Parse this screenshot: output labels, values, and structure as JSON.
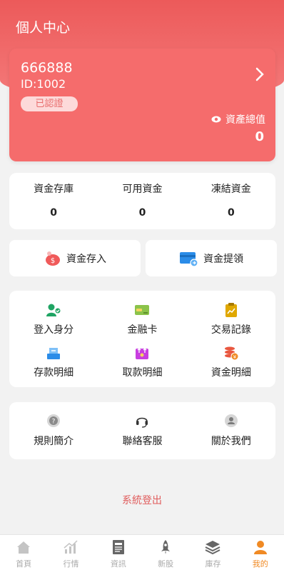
{
  "header": {
    "title": "個人中心"
  },
  "account": {
    "name": "666888",
    "id": "ID:1002",
    "badge": "已認證",
    "assets_label": "資產總值",
    "assets_value": "0"
  },
  "funds": [
    {
      "label": "資金存庫",
      "value": "0"
    },
    {
      "label": "可用資金",
      "value": "0"
    },
    {
      "label": "凍結資金",
      "value": "0"
    }
  ],
  "actions": {
    "deposit": {
      "label": "資金存入",
      "icon": "piggy-bank-icon"
    },
    "withdraw": {
      "label": "資金提領",
      "icon": "card-withdraw-icon"
    }
  },
  "menu": [
    {
      "label": "登入身分",
      "icon": "user-verified-icon"
    },
    {
      "label": "金融卡",
      "icon": "bank-card-icon"
    },
    {
      "label": "交易記錄",
      "icon": "clipboard-chart-icon"
    },
    {
      "label": "存款明細",
      "icon": "deposit-tray-icon"
    },
    {
      "label": "取款明細",
      "icon": "withdraw-box-icon"
    },
    {
      "label": "資金明細",
      "icon": "coins-stack-icon"
    }
  ],
  "info": [
    {
      "label": "規則簡介",
      "icon": "question-icon"
    },
    {
      "label": "聯絡客服",
      "icon": "headset-icon"
    },
    {
      "label": "關於我們",
      "icon": "about-user-icon"
    }
  ],
  "logout_label": "系統登出",
  "tabs": [
    {
      "label": "首頁",
      "icon": "home-icon"
    },
    {
      "label": "行情",
      "icon": "chart-icon"
    },
    {
      "label": "資訊",
      "icon": "news-icon"
    },
    {
      "label": "新股",
      "icon": "rocket-icon"
    },
    {
      "label": "庫存",
      "icon": "layers-icon"
    },
    {
      "label": "我的",
      "icon": "profile-icon",
      "active": true
    }
  ],
  "colors": {
    "brand": "#f56c6c",
    "active_tab": "#f08a24",
    "logout": "#e05b5b"
  }
}
